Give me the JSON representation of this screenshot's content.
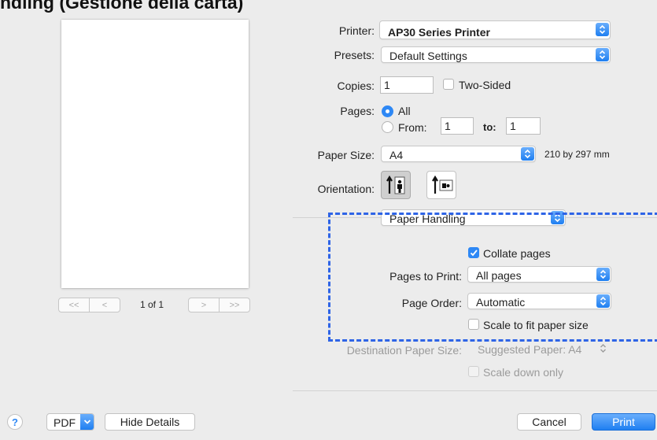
{
  "page_title": "ndling (Gestione della carta)",
  "preview": {
    "page_label": "1 of 1"
  },
  "printer": {
    "label": "Printer:",
    "value": "AP30 Series Printer"
  },
  "presets": {
    "label": "Presets:",
    "value": "Default Settings"
  },
  "copies": {
    "label": "Copies:",
    "value": "1",
    "two_sided_label": "Two-Sided",
    "two_sided_checked": false
  },
  "pages": {
    "label": "Pages:",
    "all_label": "All",
    "from_label": "From:",
    "from_value": "1",
    "to_label": "to:",
    "to_value": "1",
    "selected": "All"
  },
  "paper_size": {
    "label": "Paper Size:",
    "value": "A4",
    "dimensions": "210 by 297 mm"
  },
  "orientation": {
    "label": "Orientation:",
    "selected": "portrait"
  },
  "section_popup": {
    "value": "Paper Handling"
  },
  "paper_handling": {
    "collate_label": "Collate pages",
    "collate_checked": true,
    "pages_to_print_label": "Pages to Print:",
    "pages_to_print_value": "All pages",
    "page_order_label": "Page Order:",
    "page_order_value": "Automatic",
    "scale_fit_label": "Scale to fit paper size",
    "scale_fit_checked": false,
    "destination_label": "Destination Paper Size:",
    "destination_value": "Suggested Paper: A4",
    "scale_down_label": "Scale down only",
    "scale_down_checked": false
  },
  "footer": {
    "help_symbol": "?",
    "pdf_label": "PDF",
    "hide_details_label": "Hide Details",
    "cancel_label": "Cancel",
    "print_label": "Print"
  },
  "colors": {
    "accent": "#2e88f5",
    "highlight_dashed": "#2e64e6"
  },
  "icons": [
    "stepper-icon",
    "chevron-left-icon",
    "chevron-right-icon",
    "portrait-icon",
    "landscape-icon",
    "help-icon",
    "chevron-down-icon",
    "checkmark-icon"
  ]
}
